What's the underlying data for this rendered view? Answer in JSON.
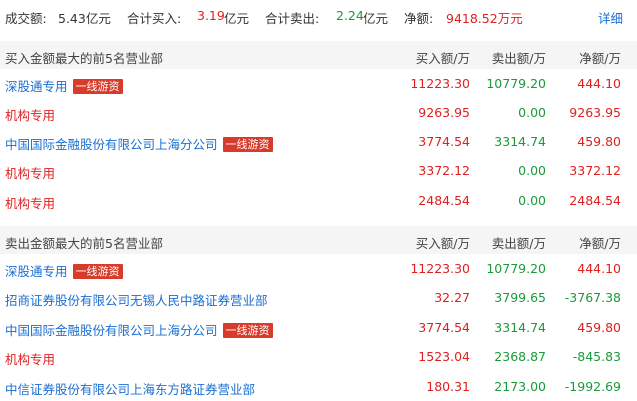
{
  "summary": {
    "turnover_label": "成交额:",
    "turnover_value": "5.43亿元",
    "buy_label": "合计买入:",
    "buy_value": "3.19",
    "buy_unit": "亿元",
    "sell_label": "合计卖出:",
    "sell_value": "2.24",
    "sell_unit": "亿元",
    "net_label": "净额:",
    "net_value": "9418.52万元",
    "detail_link": "详细"
  },
  "columns": {
    "buy": "买入额/万",
    "sell": "卖出额/万",
    "net": "净额/万"
  },
  "colors": {
    "red": "#e02020",
    "green": "#1a9a3a",
    "blue": "#1a6fd1",
    "tag": "#d83b2a"
  },
  "buy_section": {
    "title": "买入金额最大的前5名营业部",
    "rows": [
      {
        "name": "深股通专用",
        "tag": "一线游资",
        "buy": "11223.30",
        "sell": "10779.20",
        "net": "444.10"
      },
      {
        "name": "机构专用",
        "tag": "",
        "buy": "9263.95",
        "sell": "0.00",
        "net": "9263.95"
      },
      {
        "name": "中国国际金融股份有限公司上海分公司",
        "tag": "一线游资",
        "buy": "3774.54",
        "sell": "3314.74",
        "net": "459.80"
      },
      {
        "name": "机构专用",
        "tag": "",
        "buy": "3372.12",
        "sell": "0.00",
        "net": "3372.12"
      },
      {
        "name": "机构专用",
        "tag": "",
        "buy": "2484.54",
        "sell": "0.00",
        "net": "2484.54"
      }
    ]
  },
  "sell_section": {
    "title": "卖出金额最大的前5名营业部",
    "rows": [
      {
        "name": "深股通专用",
        "tag": "一线游资",
        "buy": "11223.30",
        "sell": "10779.20",
        "net": "444.10"
      },
      {
        "name": "招商证券股份有限公司无锡人民中路证券营业部",
        "tag": "",
        "buy": "32.27",
        "sell": "3799.65",
        "net": "-3767.38"
      },
      {
        "name": "中国国际金融股份有限公司上海分公司",
        "tag": "一线游资",
        "buy": "3774.54",
        "sell": "3314.74",
        "net": "459.80"
      },
      {
        "name": "机构专用",
        "tag": "",
        "buy": "1523.04",
        "sell": "2368.87",
        "net": "-845.83"
      },
      {
        "name": "中信证券股份有限公司上海东方路证券营业部",
        "tag": "",
        "buy": "180.31",
        "sell": "2173.00",
        "net": "-1992.69"
      }
    ]
  }
}
